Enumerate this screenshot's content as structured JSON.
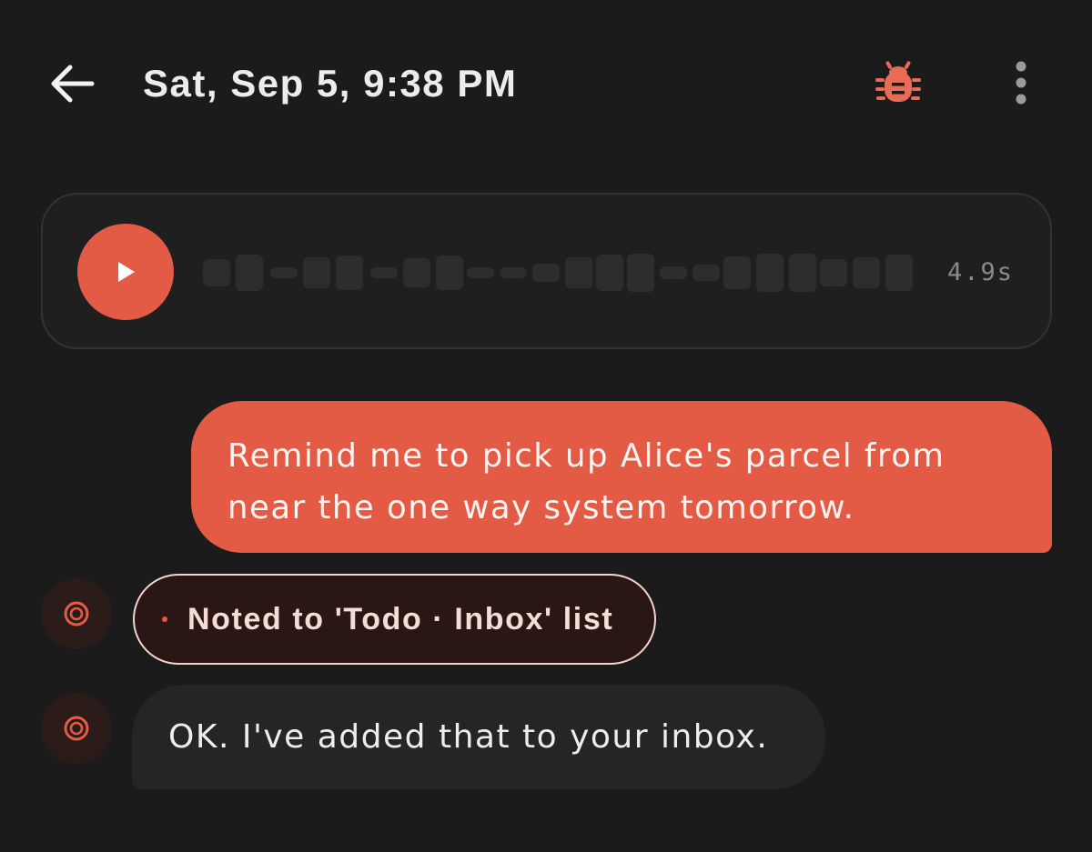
{
  "header": {
    "title": "Sat, Sep 5, 9:38 PM",
    "back_icon": "arrow-left-icon",
    "debug_icon": "bug-icon",
    "menu_icon": "more-vert-icon"
  },
  "audio": {
    "duration": "4.9s",
    "play_icon": "play-icon"
  },
  "messages": {
    "user_text": "Remind me to pick up Alice's parcel from near the one way system tomorrow.",
    "action_chip": "Noted to 'Todo · Inbox' list",
    "assistant_text": "OK. I've added that to your inbox."
  },
  "colors": {
    "accent": "#e45b45",
    "background": "#1b1b1b",
    "chip_border": "#f3d5cc"
  }
}
